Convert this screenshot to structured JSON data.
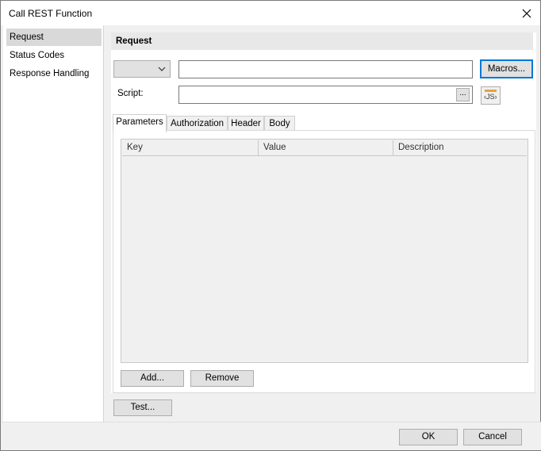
{
  "window": {
    "title": "Call REST Function"
  },
  "sidebar": {
    "items": [
      {
        "label": "Request"
      },
      {
        "label": "Status Codes"
      },
      {
        "label": "Response Handling"
      }
    ]
  },
  "request": {
    "header": "Request",
    "method_value": "",
    "url_value": "",
    "macros_label": "Macros...",
    "script_label": "Script:",
    "script_value": "",
    "ellipsis_label": "...",
    "js_label": "‹JS›"
  },
  "tabs": [
    {
      "label": "Parameters"
    },
    {
      "label": "Authorization"
    },
    {
      "label": "Header"
    },
    {
      "label": "Body"
    }
  ],
  "grid": {
    "columns": [
      "Key",
      "Value",
      "Description"
    ]
  },
  "buttons": {
    "add": "Add...",
    "remove": "Remove",
    "test": "Test...",
    "ok": "OK",
    "cancel": "Cancel"
  },
  "icons": {
    "close": "close-icon",
    "dropdown": "chevron-down-icon",
    "js": "javascript-icon"
  }
}
